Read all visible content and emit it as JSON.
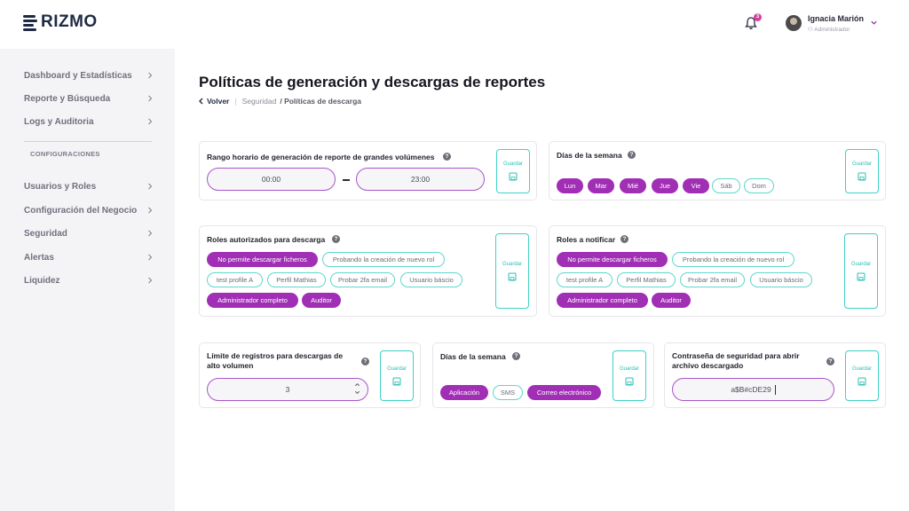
{
  "brand": {
    "logo_text": "RIZMO"
  },
  "header": {
    "notification_count": "3",
    "user_name": "Ignacia Marión",
    "user_role": "Administrador"
  },
  "sidebar": {
    "items_top": [
      {
        "label": "Dashboard y Estadísticas"
      },
      {
        "label": "Reporte y Búsqueda"
      },
      {
        "label": "Logs y Auditoria"
      }
    ],
    "section_title": "CONFIGURACIONES",
    "items_bottom": [
      {
        "label": "Usuarios y Roles"
      },
      {
        "label": "Configuración del Negocio"
      },
      {
        "label": "Seguridad"
      },
      {
        "label": "Alertas"
      },
      {
        "label": "Liquidez"
      }
    ]
  },
  "page": {
    "title": "Políticas de generación y descargas de reportes",
    "breadcrumb": {
      "back": "Volver",
      "parent": "Seguridad",
      "current": "/ Políticas de descarga"
    }
  },
  "save_label": "Guardar",
  "help_glyph": "?",
  "cards": {
    "time_range": {
      "title": "Rango horario de generación de reporte de grandes volúmenes",
      "start": "00:00",
      "end": "23:00"
    },
    "weekdays": {
      "title": "Días de la semana",
      "days": [
        {
          "label": "Lun",
          "selected": true
        },
        {
          "label": "Mar",
          "selected": true
        },
        {
          "label": "Mié",
          "selected": true
        },
        {
          "label": "Jue",
          "selected": true
        },
        {
          "label": "Vie",
          "selected": true
        },
        {
          "label": "Sáb",
          "selected": false
        },
        {
          "label": "Dom",
          "selected": false
        }
      ]
    },
    "download_roles": {
      "title": "Roles autorizados para descarga",
      "roles": [
        {
          "label": "No permite descargar ficheros",
          "selected": true
        },
        {
          "label": "Probando la creación de nuevo rol",
          "selected": false
        },
        {
          "label": "test profile A",
          "selected": false
        },
        {
          "label": "Perfil Mathias",
          "selected": false
        },
        {
          "label": "Probar 2fa email",
          "selected": false
        },
        {
          "label": "Usuario báscio",
          "selected": false
        },
        {
          "label": "Administrador completo",
          "selected": true
        },
        {
          "label": "Auditor",
          "selected": true
        }
      ]
    },
    "notify_roles": {
      "title": "Roles a notificar",
      "roles": [
        {
          "label": "No permite descargar ficheros",
          "selected": true
        },
        {
          "label": "Probando la creación de nuevo rol",
          "selected": false
        },
        {
          "label": "test profile A",
          "selected": false
        },
        {
          "label": "Perfil Mathias",
          "selected": false
        },
        {
          "label": "Probar 2fa email",
          "selected": false
        },
        {
          "label": "Usuario báscio",
          "selected": false
        },
        {
          "label": "Administrador completo",
          "selected": true
        },
        {
          "label": "Auditor",
          "selected": true
        }
      ]
    },
    "record_limit": {
      "title": "Límite de registros para descargas de alto volumen",
      "value": "3"
    },
    "channels": {
      "title": "Días de la semana",
      "options": [
        {
          "label": "Aplicación",
          "selected": true
        },
        {
          "label": "SMS",
          "selected": false
        },
        {
          "label": "Correo electrónico",
          "selected": true
        }
      ]
    },
    "password": {
      "title": "Contraseña de seguridad para abrir archivo descargado",
      "value": "a$B#cDE29"
    }
  },
  "colors": {
    "accent": "#a12fb5",
    "teal": "#3fd1c7",
    "badge": "#d93fa0"
  }
}
